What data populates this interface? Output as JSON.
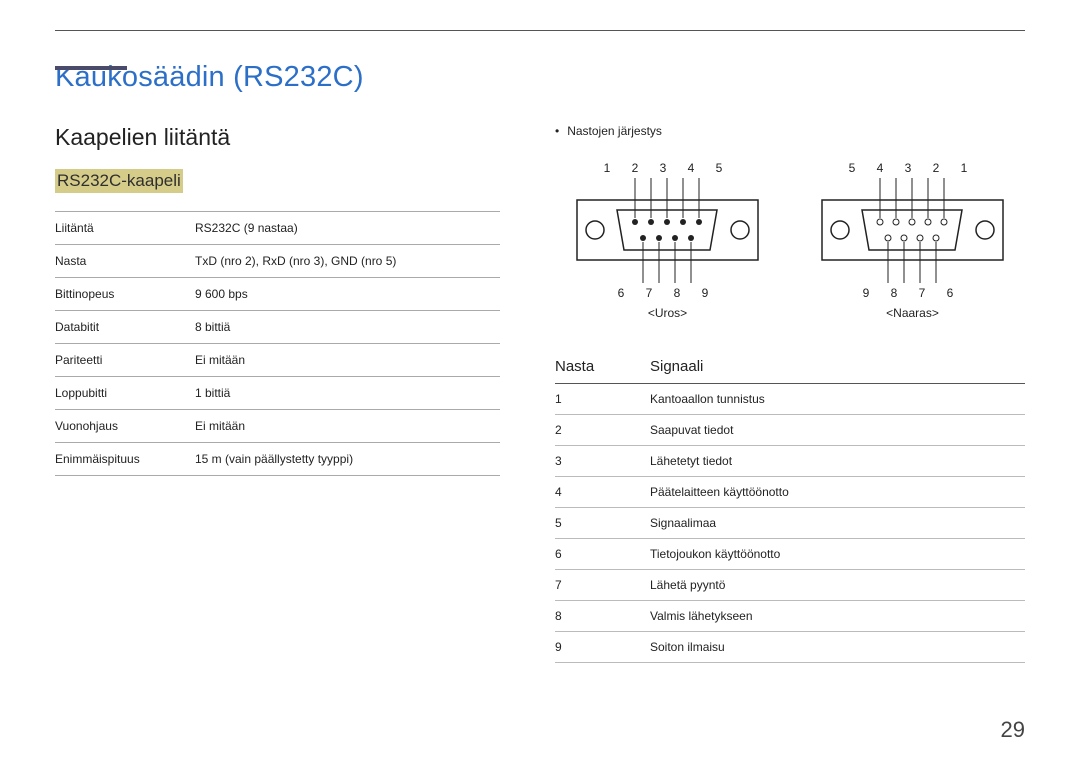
{
  "page_number": "29",
  "title": "Kaukosäädin (RS232C)",
  "section_heading": "Kaapelien liitäntä",
  "subsection_heading": "RS232C-kaapeli",
  "spec_table": [
    {
      "label": "Liitäntä",
      "value": "RS232C (9 nastaa)"
    },
    {
      "label": "Nasta",
      "value": "TxD (nro 2), RxD (nro 3), GND (nro 5)"
    },
    {
      "label": "Bittinopeus",
      "value": "9 600 bps"
    },
    {
      "label": "Databitit",
      "value": "8 bittiä"
    },
    {
      "label": "Pariteetti",
      "value": "Ei mitään"
    },
    {
      "label": "Loppubitti",
      "value": "1 bittiä"
    },
    {
      "label": "Vuonohjaus",
      "value": "Ei mitään"
    },
    {
      "label": "Enimmäispituus",
      "value": "15 m (vain päällystetty tyyppi)"
    }
  ],
  "pin_order_label": "Nastojen järjestys",
  "connectors": [
    {
      "top_nums": "1 2 3 4 5",
      "bot_nums": "6 7 8 9",
      "label": "<Uros>"
    },
    {
      "top_nums": "5 4 3 2 1",
      "bot_nums": "9 8 7 6",
      "label": "<Naaras>"
    }
  ],
  "signal_table": {
    "head_pin": "Nasta",
    "head_signal": "Signaali",
    "rows": [
      {
        "pin": "1",
        "signal": "Kantoaallon tunnistus"
      },
      {
        "pin": "2",
        "signal": "Saapuvat tiedot"
      },
      {
        "pin": "3",
        "signal": "Lähetetyt tiedot"
      },
      {
        "pin": "4",
        "signal": "Päätelaitteen käyttöönotto"
      },
      {
        "pin": "5",
        "signal": "Signaalimaa"
      },
      {
        "pin": "6",
        "signal": "Tietojoukon käyttöönotto"
      },
      {
        "pin": "7",
        "signal": "Lähetä pyyntö"
      },
      {
        "pin": "8",
        "signal": "Valmis lähetykseen"
      },
      {
        "pin": "9",
        "signal": "Soiton ilmaisu"
      }
    ]
  }
}
